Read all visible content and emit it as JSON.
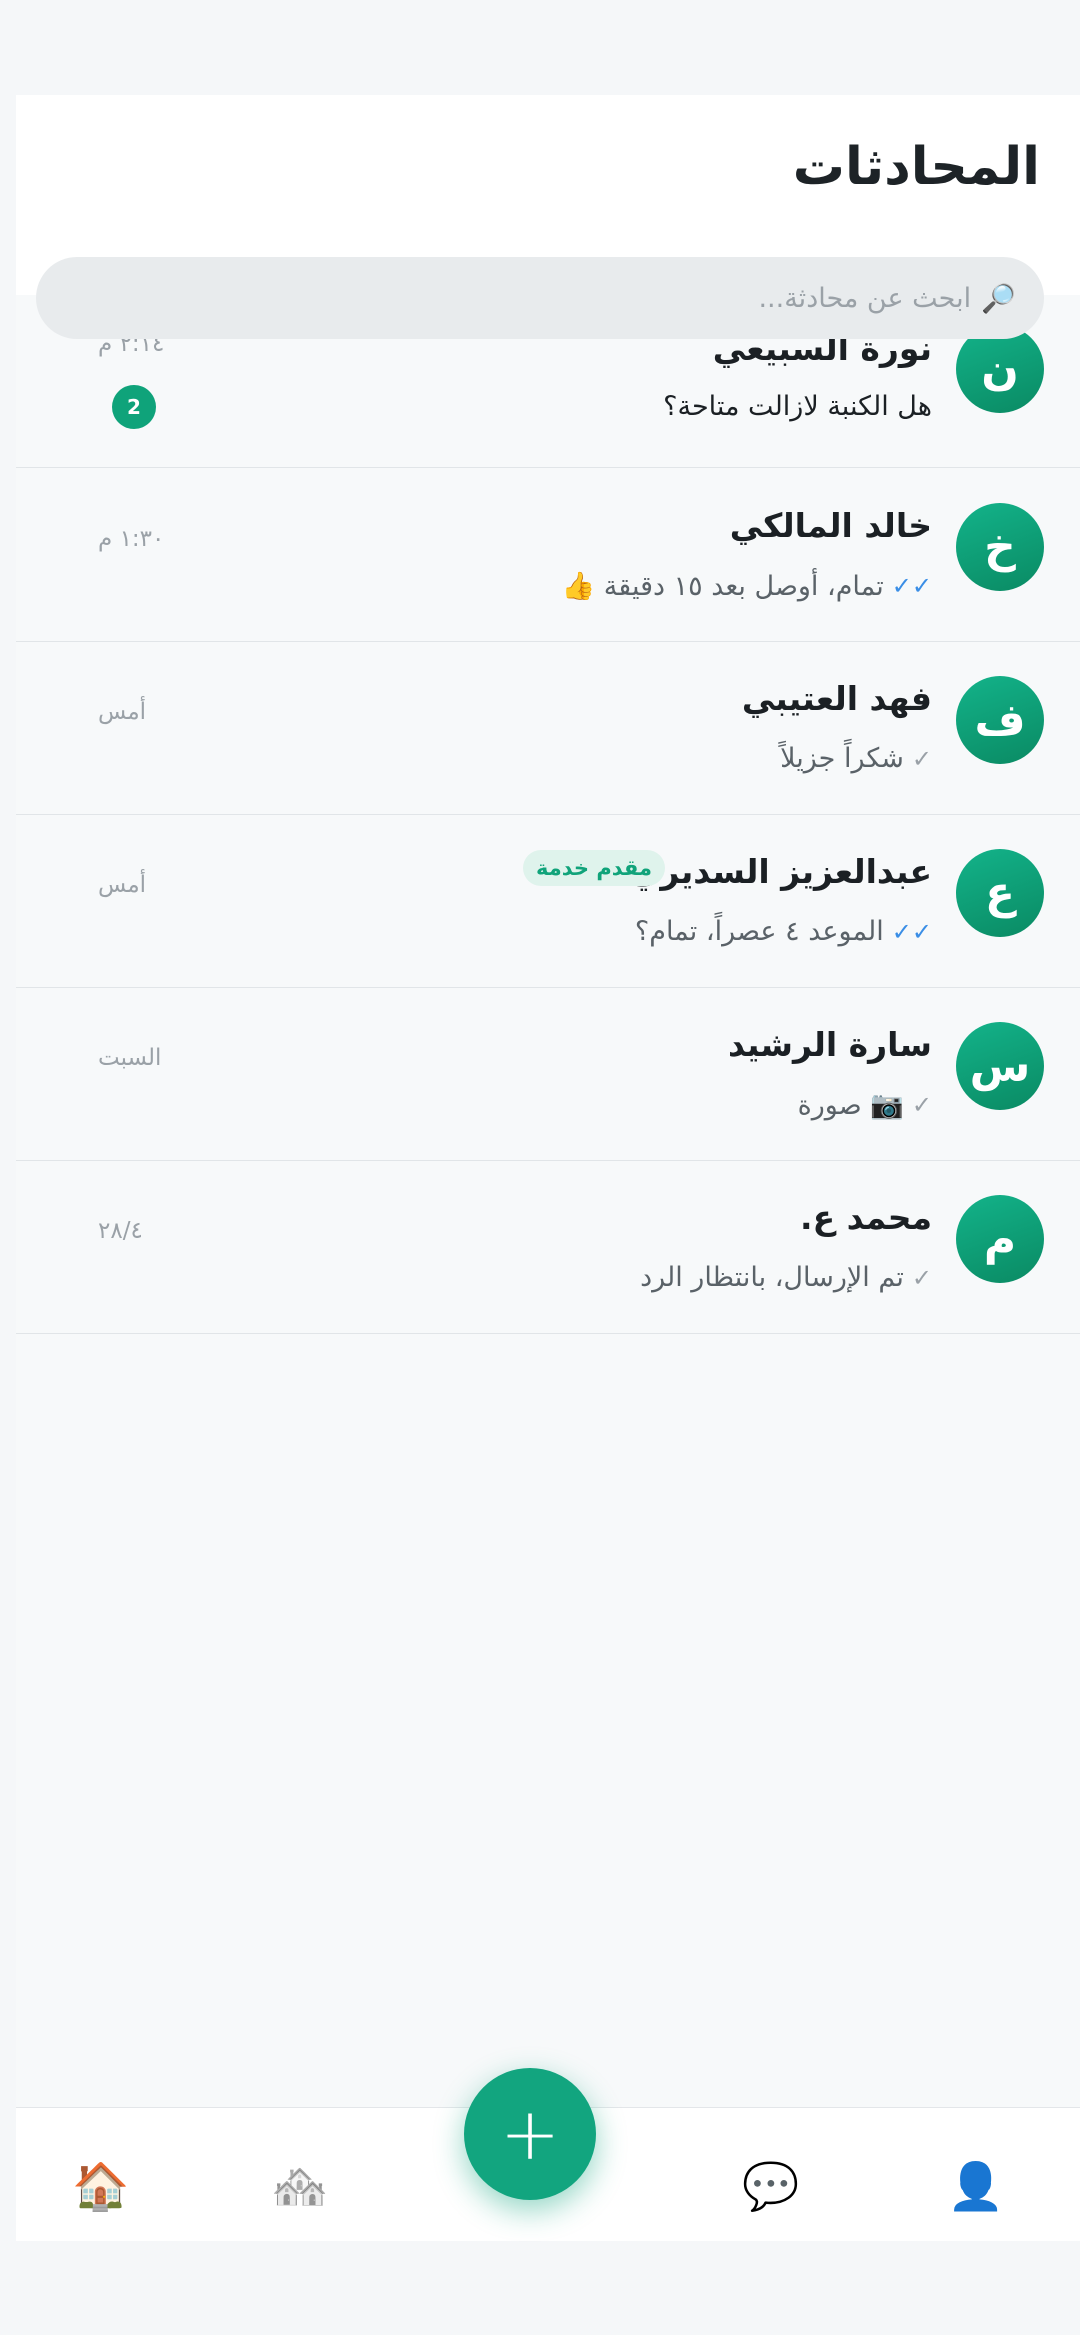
{
  "header": {
    "title": "المحادثات",
    "search_placeholder": "ابحث عن محادثة...",
    "search_icon": "🔎"
  },
  "chats": [
    {
      "avatar_letter": "ن",
      "name": "نورة السبيعي",
      "time": "٢:١٤ م",
      "preview": "هل الكنبة لازالت متاحة؟",
      "status": "",
      "unread": "2"
    },
    {
      "avatar_letter": "خ",
      "name": "خالد المالكي",
      "time": "١:٣٠ م",
      "preview": "تمام، أوصل بعد ١٥ دقيقة 👍",
      "status": "✓✓"
    },
    {
      "avatar_letter": "ف",
      "name": "فهد العتيبي",
      "time": "أمس",
      "preview": "شكراً جزيلاً",
      "status": "✓"
    },
    {
      "avatar_letter": "ع",
      "name": "عبدالعزيز السديري",
      "badge": "مقدم خدمة",
      "time": "أمس",
      "preview": "الموعد ٤ عصراً، تمام؟",
      "status": "✓✓"
    },
    {
      "avatar_letter": "س",
      "name": "سارة الرشيد",
      "time": "السبت",
      "preview": "📷 صورة",
      "status": "✓"
    },
    {
      "avatar_letter": "م",
      "name": "محمد ع.",
      "time": "٢٨/٤",
      "preview": "تم الإرسال، بانتظار الرد",
      "status": "✓"
    }
  ],
  "nav": {
    "home_icon": "🏠",
    "listings_icon": "🏘️",
    "add_label": "+",
    "chat_icon": "💬",
    "profile_icon": "👤"
  },
  "colors": {
    "accent": "#12a57f",
    "read_tick": "#3a8ee6",
    "badge_bg": "#dff3ec"
  }
}
